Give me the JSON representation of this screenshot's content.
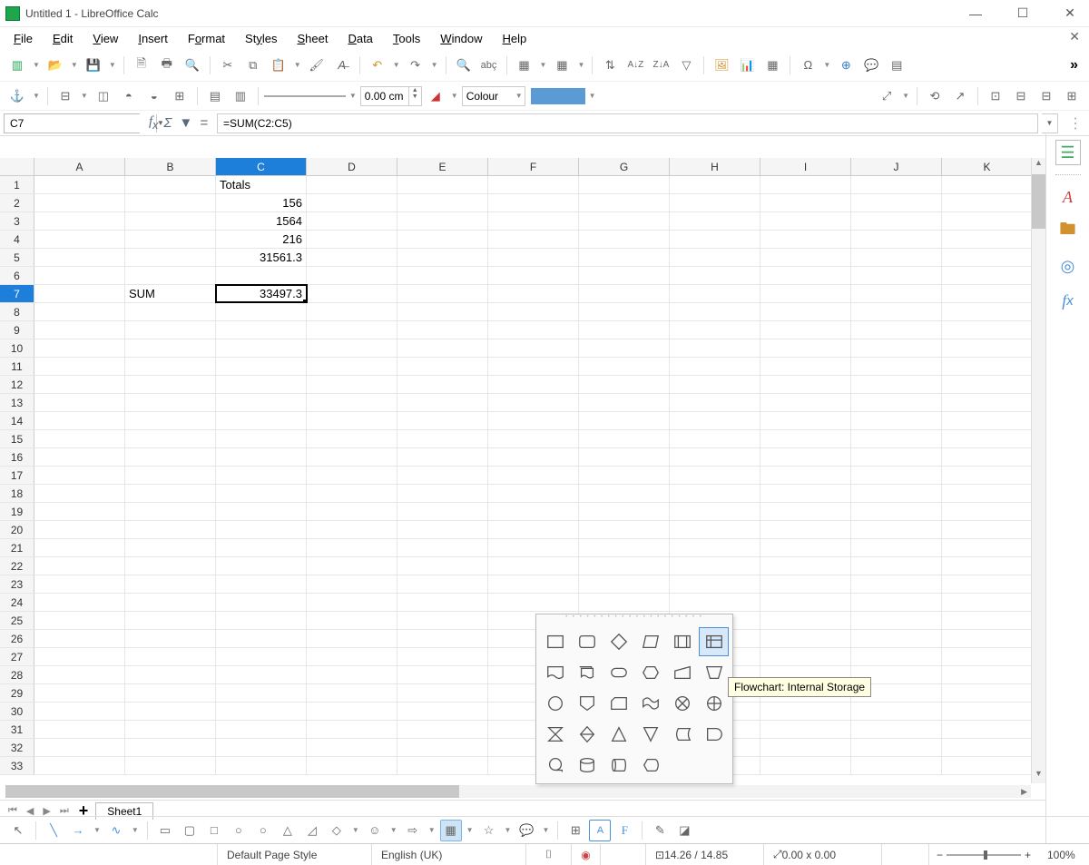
{
  "window": {
    "title": "Untitled 1 - LibreOffice Calc"
  },
  "menu": {
    "file": "File",
    "edit": "Edit",
    "view": "View",
    "insert": "Insert",
    "format": "Format",
    "styles": "Styles",
    "sheet": "Sheet",
    "data": "Data",
    "tools": "Tools",
    "window": "Window",
    "help": "Help"
  },
  "toolbar2": {
    "line_width": "0.00 cm",
    "fill_label": "Colour"
  },
  "formula": {
    "name_box": "C7",
    "formula": "=SUM(C2:C5)"
  },
  "columns": [
    "A",
    "B",
    "C",
    "D",
    "E",
    "F",
    "G",
    "H",
    "I",
    "J",
    "K"
  ],
  "active_col_index": 2,
  "rows": 33,
  "active_row": 7,
  "cells": {
    "C1": {
      "value": "Totals",
      "type": "txt"
    },
    "C2": {
      "value": "156",
      "type": "num"
    },
    "C3": {
      "value": "1564",
      "type": "num"
    },
    "C4": {
      "value": "216",
      "type": "num"
    },
    "C5": {
      "value": "31561.3",
      "type": "num"
    },
    "B7": {
      "value": "SUM",
      "type": "txt"
    },
    "C7": {
      "value": "33497.3",
      "type": "num",
      "cursor": true
    }
  },
  "sheet_tab": "Sheet1",
  "status": {
    "page_style": "Default Page Style",
    "language": "English (UK)",
    "coords": "14.26 / 14.85",
    "size": "0.00 x 0.00",
    "zoom": "100%"
  },
  "tooltip": "Flowchart: Internal Storage"
}
